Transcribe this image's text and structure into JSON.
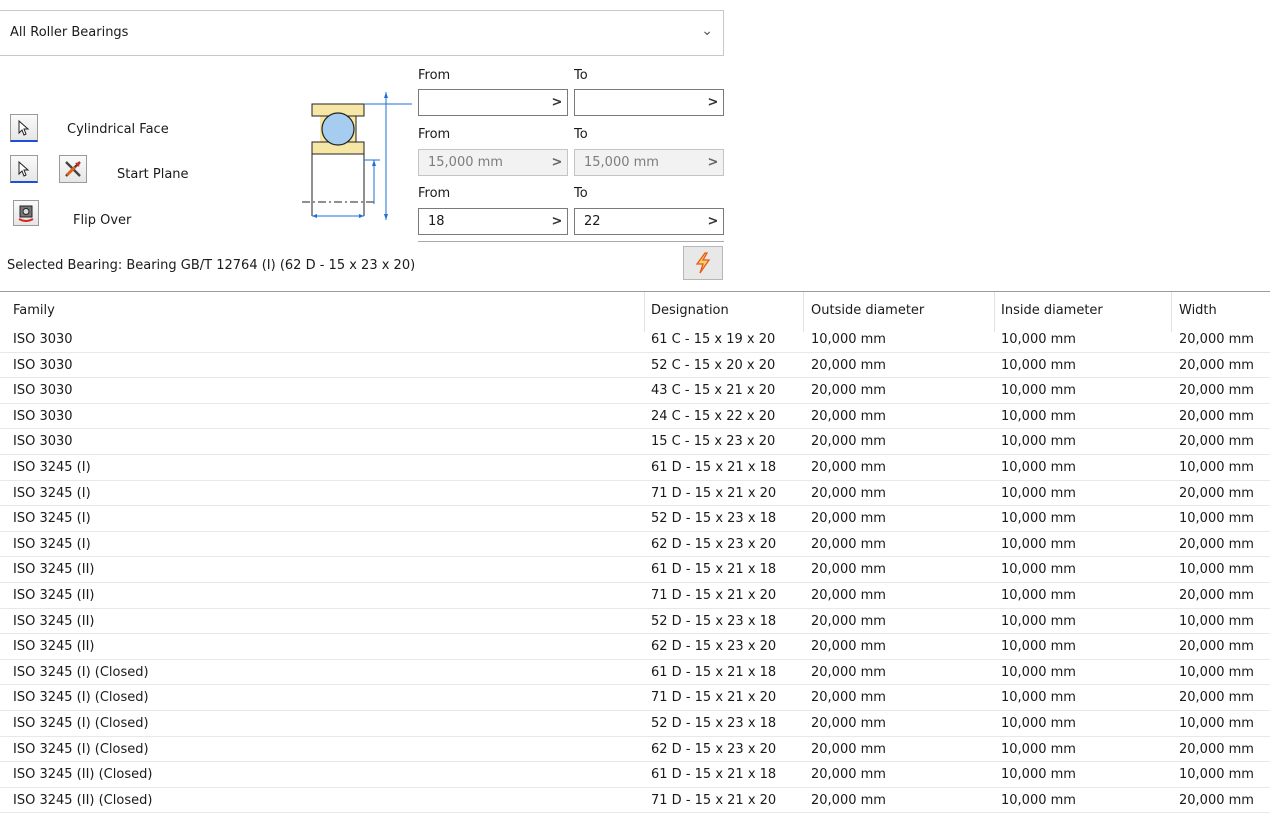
{
  "filter": {
    "selected": "All Roller Bearings"
  },
  "tools": {
    "cylindrical_face": "Cylindrical Face",
    "start_plane": "Start Plane",
    "flip_over": "Flip Over"
  },
  "ranges": [
    {
      "from_label": "From",
      "to_label": "To",
      "from_value": "",
      "to_value": "",
      "disabled": false
    },
    {
      "from_label": "From",
      "to_label": "To",
      "from_value": "15,000 mm",
      "to_value": "15,000 mm",
      "disabled": true
    },
    {
      "from_label": "From",
      "to_label": "To",
      "from_value": "18",
      "to_value": "22",
      "disabled": false
    }
  ],
  "selected_bearing": "Selected Bearing: Bearing GB/T 12764 (I) (62 D - 15 x 23 x 20)",
  "table": {
    "columns": [
      "Family",
      "Designation",
      "Outside diameter",
      "Inside diameter",
      "Width"
    ],
    "rows": [
      [
        "ISO 3030",
        "61 C - 15 x 19 x 20",
        "10,000 mm",
        "10,000 mm",
        "20,000 mm"
      ],
      [
        "ISO 3030",
        "52 C - 15 x 20 x 20",
        "20,000 mm",
        "10,000 mm",
        "20,000 mm"
      ],
      [
        "ISO 3030",
        "43 C - 15 x 21 x 20",
        "20,000 mm",
        "10,000 mm",
        "20,000 mm"
      ],
      [
        "ISO 3030",
        "24 C - 15 x 22 x 20",
        "20,000 mm",
        "10,000 mm",
        "20,000 mm"
      ],
      [
        "ISO 3030",
        "15 C - 15 x 23 x 20",
        "20,000 mm",
        "10,000 mm",
        "20,000 mm"
      ],
      [
        "ISO 3245 (I)",
        "61 D - 15 x 21 x 18",
        "20,000 mm",
        "10,000 mm",
        "10,000 mm"
      ],
      [
        "ISO 3245 (I)",
        "71 D - 15 x 21 x 20",
        "20,000 mm",
        "10,000 mm",
        "20,000 mm"
      ],
      [
        "ISO 3245 (I)",
        "52 D - 15 x 23 x 18",
        "20,000 mm",
        "10,000 mm",
        "10,000 mm"
      ],
      [
        "ISO 3245 (I)",
        "62 D - 15 x 23 x 20",
        "20,000 mm",
        "10,000 mm",
        "20,000 mm"
      ],
      [
        "ISO 3245 (II)",
        "61 D - 15 x 21 x 18",
        "20,000 mm",
        "10,000 mm",
        "10,000 mm"
      ],
      [
        "ISO 3245 (II)",
        "71 D - 15 x 21 x 20",
        "20,000 mm",
        "10,000 mm",
        "20,000 mm"
      ],
      [
        "ISO 3245 (II)",
        "52 D - 15 x 23 x 18",
        "20,000 mm",
        "10,000 mm",
        "10,000 mm"
      ],
      [
        "ISO 3245 (II)",
        "62 D - 15 x 23 x 20",
        "20,000 mm",
        "10,000 mm",
        "20,000 mm"
      ],
      [
        "ISO 3245 (I) (Closed)",
        "61 D - 15 x 21 x 18",
        "20,000 mm",
        "10,000 mm",
        "10,000 mm"
      ],
      [
        "ISO 3245 (I) (Closed)",
        "71 D - 15 x 21 x 20",
        "20,000 mm",
        "10,000 mm",
        "20,000 mm"
      ],
      [
        "ISO 3245 (I) (Closed)",
        "52 D - 15 x 23 x 18",
        "20,000 mm",
        "10,000 mm",
        "10,000 mm"
      ],
      [
        "ISO 3245 (I) (Closed)",
        "62 D - 15 x 23 x 20",
        "20,000 mm",
        "10,000 mm",
        "20,000 mm"
      ],
      [
        "ISO 3245 (II) (Closed)",
        "61 D - 15 x 21 x 18",
        "20,000 mm",
        "10,000 mm",
        "10,000 mm"
      ],
      [
        "ISO 3245 (II) (Closed)",
        "71 D - 15 x 21 x 20",
        "20,000 mm",
        "10,000 mm",
        "20,000 mm"
      ]
    ]
  }
}
